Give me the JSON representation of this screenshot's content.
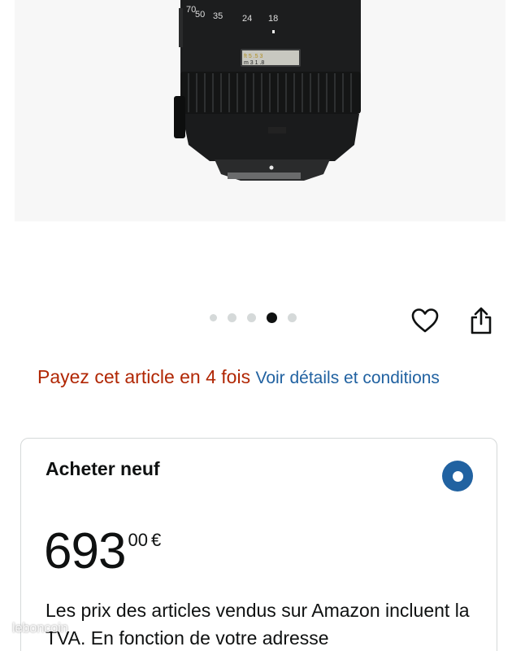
{
  "product_image": {
    "alt": "Nikon zoom lens",
    "focal_scale": [
      "70",
      "50",
      "35",
      "24",
      "18"
    ],
    "distance_window": {
      "top": "ft 5  .5  3",
      "bottom": "m  3     1   .8"
    }
  },
  "carousel": {
    "total": 5,
    "active_index": 3
  },
  "actions": {
    "wishlist_icon": "heart-icon",
    "share_icon": "share-icon"
  },
  "promo": {
    "installment_text": "Payez cet article en 4 fois",
    "details_link": "Voir détails et conditions"
  },
  "buybox": {
    "title": "Acheter neuf",
    "selected": true,
    "price": {
      "whole": "693",
      "fraction": "00",
      "currency": "€"
    },
    "tax_note": "Les prix des articles vendus sur Amazon incluent la TVA. En fonction de votre adresse"
  },
  "watermark": {
    "text": "leboncoin"
  },
  "colors": {
    "promo_red": "#b12704",
    "link_blue": "#2162a1",
    "radio_blue": "#2162a1",
    "text": "#0f1111",
    "border": "#d5d9d9"
  }
}
